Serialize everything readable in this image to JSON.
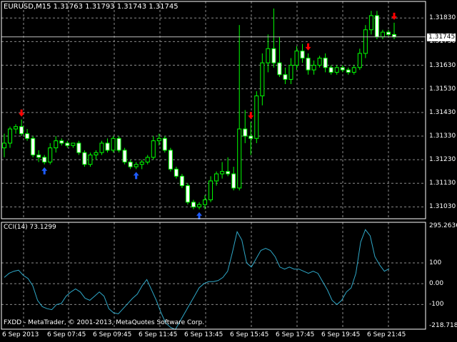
{
  "symbol_header": "EURUSD,M15  1.31763 1.31793 1.31743 1.31745",
  "current_price_label": "1.31745",
  "price_axis": [
    "1.31830",
    "1.31730",
    "1.31630",
    "1.31530",
    "1.31430",
    "1.31330",
    "1.31230",
    "1.31130",
    "1.31030"
  ],
  "cci_title": "CCI(14) 73.1299",
  "cci_axis": [
    "295.2636",
    "100",
    "0.00",
    "-100",
    "-218.7185"
  ],
  "time_axis": [
    "6 Sep 2013",
    "6 Sep 07:45",
    "6 Sep 09:45",
    "6 Sep 11:45",
    "6 Sep 13:45",
    "6 Sep 15:45",
    "6 Sep 17:45",
    "6 Sep 19:45",
    "6 Sep 21:45"
  ],
  "copyright": "FXDD - MetaTrader, © 2001-2013, MetaQuotes Software Corp.",
  "colors": {
    "background": "#000000",
    "grid": "#8c8c8c",
    "candle": "#00ff00",
    "bull_body": "#000000",
    "bear_body": "#ffffff",
    "cci_line": "#2fa8c8",
    "sell_arrow": "#ff0000",
    "buy_arrow": "#1e5cff",
    "axis_text": "#ffffff"
  },
  "chart_data": [
    {
      "type": "candlestick",
      "title": "EURUSD,M15",
      "ylim": [
        1.3098,
        1.319
      ],
      "candles": [
        [
          1.3128,
          1.3134,
          1.3124,
          1.313
        ],
        [
          1.313,
          1.3137,
          1.3128,
          1.3136
        ],
        [
          1.3136,
          1.3138,
          1.3134,
          1.3137
        ],
        [
          1.3137,
          1.314,
          1.3133,
          1.3134
        ],
        [
          1.3134,
          1.3136,
          1.3131,
          1.3132
        ],
        [
          1.3132,
          1.3133,
          1.3124,
          1.3125
        ],
        [
          1.3125,
          1.3127,
          1.3122,
          1.3124
        ],
        [
          1.3124,
          1.3125,
          1.3121,
          1.3122
        ],
        [
          1.3122,
          1.313,
          1.3121,
          1.3128
        ],
        [
          1.3128,
          1.3133,
          1.3126,
          1.3131
        ],
        [
          1.3131,
          1.3132,
          1.3129,
          1.313
        ],
        [
          1.313,
          1.3131,
          1.3128,
          1.3129
        ],
        [
          1.3129,
          1.313,
          1.3128,
          1.313
        ],
        [
          1.313,
          1.3131,
          1.3125,
          1.3126
        ],
        [
          1.3126,
          1.3127,
          1.312,
          1.3121
        ],
        [
          1.3121,
          1.3126,
          1.312,
          1.3125
        ],
        [
          1.3125,
          1.3127,
          1.3123,
          1.3126
        ],
        [
          1.3126,
          1.3131,
          1.3125,
          1.313
        ],
        [
          1.313,
          1.3132,
          1.3126,
          1.3127
        ],
        [
          1.3127,
          1.3133,
          1.3126,
          1.3132
        ],
        [
          1.3132,
          1.3133,
          1.3126,
          1.3127
        ],
        [
          1.3127,
          1.3128,
          1.3121,
          1.3122
        ],
        [
          1.3122,
          1.3123,
          1.3119,
          1.312
        ],
        [
          1.312,
          1.3122,
          1.3119,
          1.3121
        ],
        [
          1.3121,
          1.3123,
          1.3119,
          1.3122
        ],
        [
          1.3122,
          1.3125,
          1.3121,
          1.3124
        ],
        [
          1.3124,
          1.3133,
          1.3123,
          1.3131
        ],
        [
          1.3131,
          1.3134,
          1.3129,
          1.3132
        ],
        [
          1.3132,
          1.3133,
          1.3126,
          1.3127
        ],
        [
          1.3127,
          1.3128,
          1.3118,
          1.3119
        ],
        [
          1.3119,
          1.312,
          1.3115,
          1.3116
        ],
        [
          1.3116,
          1.3117,
          1.3111,
          1.3112
        ],
        [
          1.3112,
          1.3113,
          1.3104,
          1.3105
        ],
        [
          1.3105,
          1.3106,
          1.3102,
          1.3103
        ],
        [
          1.3103,
          1.3105,
          1.3102,
          1.3104
        ],
        [
          1.3104,
          1.3108,
          1.3102,
          1.3106
        ],
        [
          1.3106,
          1.3116,
          1.3105,
          1.3114
        ],
        [
          1.3114,
          1.3118,
          1.3112,
          1.3117
        ],
        [
          1.3117,
          1.3122,
          1.3115,
          1.3118
        ],
        [
          1.3118,
          1.3124,
          1.3116,
          1.3117
        ],
        [
          1.3117,
          1.312,
          1.311,
          1.3111
        ],
        [
          1.3111,
          1.318,
          1.311,
          1.3136
        ],
        [
          1.3136,
          1.3144,
          1.313,
          1.3133
        ],
        [
          1.3133,
          1.3139,
          1.3125,
          1.3132
        ],
        [
          1.3132,
          1.3152,
          1.313,
          1.315
        ],
        [
          1.315,
          1.3168,
          1.3146,
          1.3164
        ],
        [
          1.3164,
          1.3176,
          1.316,
          1.317
        ],
        [
          1.317,
          1.3187,
          1.3162,
          1.3164
        ],
        [
          1.3164,
          1.3175,
          1.3158,
          1.3159
        ],
        [
          1.3159,
          1.3162,
          1.3155,
          1.3157
        ],
        [
          1.3157,
          1.3166,
          1.3155,
          1.3163
        ],
        [
          1.3163,
          1.3171,
          1.3161,
          1.3169
        ],
        [
          1.3169,
          1.3172,
          1.3164,
          1.3166
        ],
        [
          1.3166,
          1.3168,
          1.3159,
          1.3161
        ],
        [
          1.3161,
          1.3165,
          1.3159,
          1.3163
        ],
        [
          1.3163,
          1.3167,
          1.3162,
          1.3166
        ],
        [
          1.3166,
          1.3168,
          1.316,
          1.3162
        ],
        [
          1.3162,
          1.3163,
          1.3159,
          1.316
        ],
        [
          1.316,
          1.3163,
          1.3159,
          1.3162
        ],
        [
          1.3162,
          1.3163,
          1.316,
          1.3161
        ],
        [
          1.3161,
          1.3162,
          1.3159,
          1.316
        ],
        [
          1.316,
          1.3163,
          1.3159,
          1.3162
        ],
        [
          1.3162,
          1.317,
          1.3161,
          1.3168
        ],
        [
          1.3168,
          1.318,
          1.3166,
          1.3178
        ],
        [
          1.3178,
          1.3186,
          1.3176,
          1.3184
        ],
        [
          1.3184,
          1.3186,
          1.3174,
          1.3175
        ],
        [
          1.3175,
          1.3178,
          1.3174,
          1.3177
        ],
        [
          1.3177,
          1.3178,
          1.3175,
          1.3176
        ],
        [
          1.3176,
          1.3181,
          1.3174,
          1.3175
        ]
      ],
      "sell_arrow_candles": [
        3,
        43,
        53,
        68
      ],
      "buy_arrow_candles": [
        7,
        23,
        34
      ]
    },
    {
      "type": "line",
      "title": "CCI(14) 73.1299",
      "ylim": [
        -218.7185,
        295.2636
      ],
      "levels": [
        100,
        0,
        -100
      ],
      "values": [
        30,
        50,
        60,
        65,
        40,
        25,
        -10,
        -80,
        -110,
        -120,
        -125,
        -100,
        -95,
        -60,
        -40,
        -25,
        -40,
        -70,
        -80,
        -60,
        -40,
        -60,
        -120,
        -140,
        -145,
        -120,
        -95,
        -70,
        -50,
        -10,
        20,
        -30,
        -80,
        -140,
        -190,
        -210,
        -220,
        -180,
        -140,
        -100,
        -60,
        -20,
        0,
        10,
        10,
        15,
        30,
        60,
        150,
        250,
        210,
        100,
        80,
        120,
        160,
        170,
        160,
        130,
        80,
        70,
        80,
        70,
        70,
        60,
        50,
        60,
        50,
        10,
        -30,
        -80,
        -100,
        -80,
        -40,
        -20,
        50,
        200,
        260,
        230,
        130,
        90,
        60,
        73
      ]
    }
  ]
}
